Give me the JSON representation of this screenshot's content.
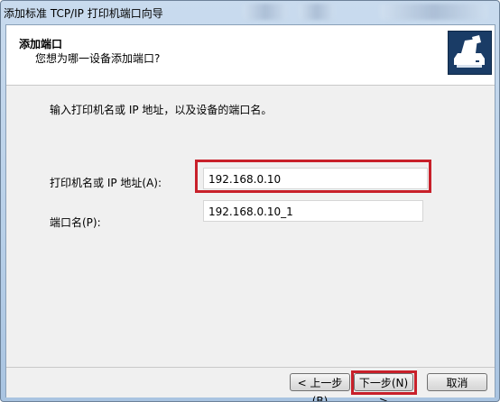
{
  "window": {
    "title": "添加标准 TCP/IP 打印机端口向导"
  },
  "header": {
    "title": "添加端口",
    "subtitle": "您想为哪一设备添加端口?"
  },
  "main": {
    "instruction": "输入打印机名或 IP 地址，以及设备的端口名。",
    "printer_name_label": "打印机名或 IP 地址(A):",
    "printer_name_value": "192.168.0.10",
    "port_name_label": "端口名(P):",
    "port_name_value": "192.168.0.10_1"
  },
  "footer": {
    "back_label": "< 上一步(B)",
    "next_label": "下一步(N) >",
    "cancel_label": "取消"
  },
  "colors": {
    "highlight": "#c8202a",
    "icon_bg": "#1a3c66"
  },
  "icons": {
    "printer": "printer-icon"
  }
}
